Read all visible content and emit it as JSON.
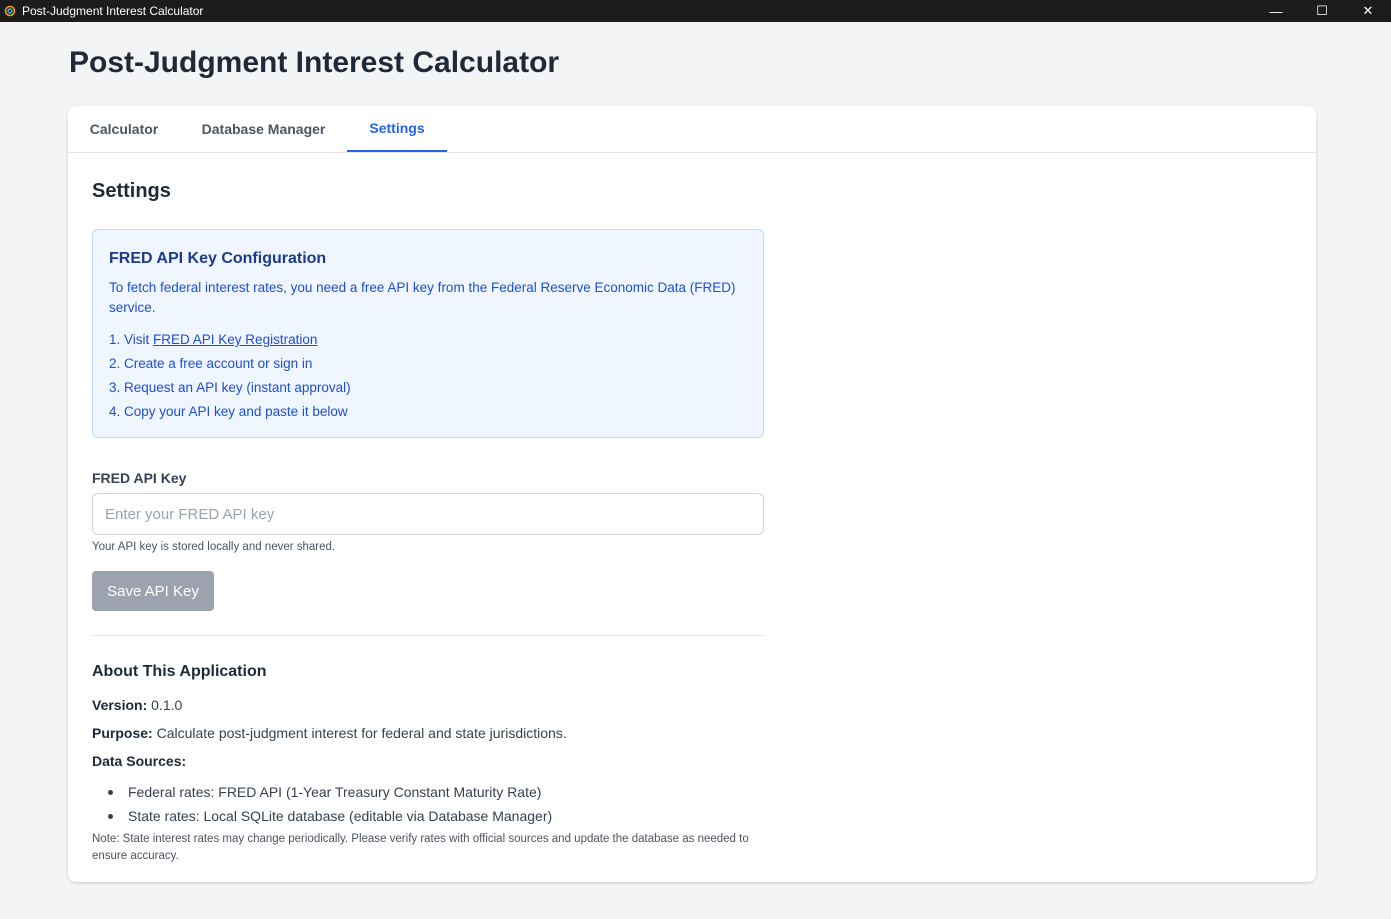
{
  "window": {
    "title": "Post-Judgment Interest Calculator",
    "controls": {
      "minimize": "—",
      "maximize": "☐",
      "close": "✕"
    }
  },
  "page": {
    "title": "Post-Judgment Interest Calculator"
  },
  "tabs": [
    {
      "label": "Calculator",
      "active": false
    },
    {
      "label": "Database Manager",
      "active": false
    },
    {
      "label": "Settings",
      "active": true
    }
  ],
  "settings": {
    "title": "Settings",
    "info": {
      "title": "FRED API Key Configuration",
      "description": "To fetch federal interest rates, you need a free API key from the Federal Reserve Economic Data (FRED) service.",
      "step1_prefix": "1. Visit ",
      "step1_link": "FRED API Key Registration",
      "step2": "2. Create a free account or sign in",
      "step3": "3. Request an API key (instant approval)",
      "step4": "4. Copy your API key and paste it below"
    },
    "api_key_label": "FRED API Key",
    "api_key_placeholder": "Enter your FRED API key",
    "api_key_value": "",
    "help_text": "Your API key is stored locally and never shared.",
    "save_button": "Save API Key"
  },
  "about": {
    "title": "About This Application",
    "version_label": "Version:",
    "version_value": "0.1.0",
    "purpose_label": "Purpose:",
    "purpose_value": "Calculate post-judgment interest for federal and state jurisdictions.",
    "sources_label": "Data Sources:",
    "sources": [
      "Federal rates: FRED API (1-Year Treasury Constant Maturity Rate)",
      "State rates: Local SQLite database (editable via Database Manager)"
    ],
    "note": "Note: State interest rates may change periodically. Please verify rates with official sources and update the database as needed to ensure accuracy."
  },
  "colors": {
    "accent": "#2563eb",
    "info_background": "#eff6ff",
    "disabled_button": "#9ca3af"
  }
}
